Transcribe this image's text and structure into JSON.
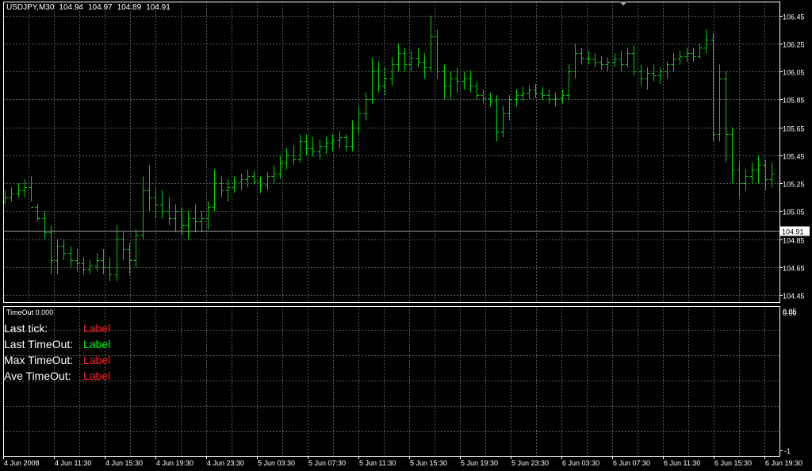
{
  "window": {
    "symbol": "USDJPY,M30",
    "ohlc": [
      "104.94",
      "104.97",
      "104.89",
      "104.91"
    ]
  },
  "colors": {
    "background": "#000000",
    "grid": "#5a5a5a",
    "bar": "#00d000",
    "axis": "#ffffff",
    "price_tag_bg": "#ffffff",
    "price_tag_fg": "#000000",
    "label_red": "#ff2020",
    "label_green": "#00ff00"
  },
  "price_axis": {
    "labels": [
      "106.45",
      "106.25",
      "106.05",
      "105.85",
      "105.65",
      "105.45",
      "105.25",
      "105.05",
      "104.85",
      "104.65",
      "104.45"
    ],
    "current_price": "104.91"
  },
  "indicator": {
    "title": "TimeOut 0.000",
    "scale_top": "0.05",
    "scale_top2": "0.00",
    "scale_bottom": "-1",
    "rows": [
      {
        "label": "Last tick:",
        "value": "Label",
        "color": "#ff2020"
      },
      {
        "label": "Last TimeOut:",
        "value": "Label",
        "color": "#00ff00"
      },
      {
        "label": "Max TimeOut:",
        "value": "Label",
        "color": "#ff2020"
      },
      {
        "label": "Ave TimeOut:",
        "value": "Label",
        "color": "#ff2020"
      }
    ]
  },
  "time_axis": {
    "labels": [
      "4 Jun 2008",
      "4 Jun 11:30",
      "4 Jun 15:30",
      "4 Jun 19:30",
      "4 Jun 23:30",
      "5 Jun 03:30",
      "5 Jun 07:30",
      "5 Jun 11:30",
      "5 Jun 15:30",
      "5 Jun 19:30",
      "5 Jun 23:30",
      "6 Jun 03:30",
      "6 Jun 07:30",
      "6 Jun 11:30",
      "6 Jun 15:30",
      "6 Jun 19:30"
    ]
  },
  "chart_data": {
    "type": "ohlc",
    "ylim": [
      104.4,
      106.55
    ],
    "grid": true,
    "series": [
      {
        "bars": [
          [
            105.12,
            105.2,
            105.1,
            105.15
          ],
          [
            105.15,
            105.22,
            105.12,
            105.18
          ],
          [
            105.18,
            105.25,
            105.15,
            105.2
          ],
          [
            105.2,
            105.28,
            105.15,
            105.22
          ],
          [
            105.22,
            105.3,
            105.12,
            105.08
          ],
          [
            105.08,
            105.1,
            104.98,
            105.0
          ],
          [
            105.0,
            105.05,
            104.85,
            104.9
          ],
          [
            104.9,
            104.95,
            104.6,
            104.7
          ],
          [
            104.7,
            104.85,
            104.6,
            104.8
          ],
          [
            104.8,
            104.85,
            104.7,
            104.75
          ],
          [
            104.75,
            104.8,
            104.65,
            104.7
          ],
          [
            104.7,
            104.78,
            104.62,
            104.68
          ],
          [
            104.68,
            104.72,
            104.6,
            104.64
          ],
          [
            104.64,
            104.7,
            104.6,
            104.66
          ],
          [
            104.66,
            104.75,
            104.62,
            104.7
          ],
          [
            104.7,
            104.78,
            104.6,
            104.65
          ],
          [
            104.65,
            104.72,
            104.55,
            104.6
          ],
          [
            104.6,
            104.95,
            104.55,
            104.85
          ],
          [
            104.85,
            104.9,
            104.7,
            104.78
          ],
          [
            104.78,
            104.82,
            104.6,
            104.7
          ],
          [
            104.7,
            104.92,
            104.65,
            104.88
          ],
          [
            104.88,
            105.3,
            104.85,
            105.2
          ],
          [
            105.2,
            105.38,
            105.05,
            105.15
          ],
          [
            105.15,
            105.22,
            105.0,
            105.1
          ],
          [
            105.1,
            105.2,
            105.0,
            105.05
          ],
          [
            105.05,
            105.15,
            104.95,
            105.0
          ],
          [
            105.0,
            105.1,
            104.9,
            105.05
          ],
          [
            105.05,
            105.08,
            104.88,
            104.95
          ],
          [
            104.95,
            105.05,
            104.85,
            105.0
          ],
          [
            105.0,
            105.1,
            104.9,
            104.98
          ],
          [
            104.98,
            105.05,
            104.9,
            105.0
          ],
          [
            105.0,
            105.12,
            104.92,
            105.08
          ],
          [
            105.08,
            105.35,
            105.05,
            105.25
          ],
          [
            105.25,
            105.3,
            105.15,
            105.2
          ],
          [
            105.2,
            105.28,
            105.12,
            105.22
          ],
          [
            105.22,
            105.3,
            105.18,
            105.26
          ],
          [
            105.26,
            105.32,
            105.2,
            105.28
          ],
          [
            105.28,
            105.35,
            105.22,
            105.3
          ],
          [
            105.3,
            105.34,
            105.24,
            105.26
          ],
          [
            105.26,
            105.3,
            105.18,
            105.24
          ],
          [
            105.24,
            105.33,
            105.2,
            105.3
          ],
          [
            105.3,
            105.38,
            105.25,
            105.32
          ],
          [
            105.32,
            105.45,
            105.28,
            105.4
          ],
          [
            105.4,
            105.5,
            105.35,
            105.45
          ],
          [
            105.45,
            105.52,
            105.38,
            105.42
          ],
          [
            105.42,
            105.6,
            105.4,
            105.55
          ],
          [
            105.55,
            105.6,
            105.45,
            105.5
          ],
          [
            105.5,
            105.58,
            105.44,
            105.48
          ],
          [
            105.48,
            105.56,
            105.42,
            105.52
          ],
          [
            105.52,
            105.58,
            105.46,
            105.54
          ],
          [
            105.54,
            105.6,
            105.48,
            105.56
          ],
          [
            105.56,
            105.62,
            105.5,
            105.58
          ],
          [
            105.58,
            105.6,
            105.48,
            105.52
          ],
          [
            105.52,
            105.7,
            105.48,
            105.65
          ],
          [
            105.65,
            105.8,
            105.6,
            105.75
          ],
          [
            105.75,
            105.9,
            105.7,
            105.85
          ],
          [
            105.85,
            106.15,
            105.82,
            106.05
          ],
          [
            106.05,
            106.12,
            105.9,
            105.95
          ],
          [
            105.95,
            106.08,
            105.88,
            106.0
          ],
          [
            106.0,
            106.15,
            105.95,
            106.1
          ],
          [
            106.1,
            106.25,
            106.05,
            106.18
          ],
          [
            106.18,
            106.22,
            106.05,
            106.1
          ],
          [
            106.1,
            106.2,
            106.05,
            106.15
          ],
          [
            106.15,
            106.22,
            106.08,
            106.12
          ],
          [
            106.12,
            106.18,
            106.0,
            106.08
          ],
          [
            106.08,
            106.45,
            106.05,
            106.3
          ],
          [
            106.3,
            106.35,
            106.0,
            106.05
          ],
          [
            106.05,
            106.1,
            105.85,
            105.95
          ],
          [
            105.95,
            106.05,
            105.85,
            106.0
          ],
          [
            106.0,
            106.08,
            105.9,
            105.98
          ],
          [
            105.98,
            106.05,
            105.92,
            106.0
          ],
          [
            106.0,
            106.06,
            105.9,
            105.95
          ],
          [
            105.95,
            105.98,
            105.85,
            105.88
          ],
          [
            105.88,
            105.92,
            105.82,
            105.86
          ],
          [
            105.86,
            105.9,
            105.8,
            105.84
          ],
          [
            105.84,
            105.88,
            105.55,
            105.62
          ],
          [
            105.62,
            105.8,
            105.58,
            105.75
          ],
          [
            105.75,
            105.88,
            105.7,
            105.85
          ],
          [
            105.85,
            105.92,
            105.8,
            105.88
          ],
          [
            105.88,
            105.94,
            105.84,
            105.9
          ],
          [
            105.9,
            105.95,
            105.85,
            105.92
          ],
          [
            105.92,
            105.96,
            105.86,
            105.9
          ],
          [
            105.9,
            105.94,
            105.84,
            105.88
          ],
          [
            105.88,
            105.92,
            105.82,
            105.85
          ],
          [
            105.85,
            105.9,
            105.8,
            105.86
          ],
          [
            105.86,
            105.92,
            105.82,
            105.88
          ],
          [
            105.88,
            106.1,
            105.85,
            106.05
          ],
          [
            106.05,
            106.25,
            106.0,
            106.18
          ],
          [
            106.18,
            106.22,
            106.1,
            106.15
          ],
          [
            106.15,
            106.2,
            106.1,
            106.14
          ],
          [
            106.14,
            106.18,
            106.08,
            106.12
          ],
          [
            106.12,
            106.16,
            106.06,
            106.1
          ],
          [
            106.1,
            106.15,
            106.05,
            106.12
          ],
          [
            106.12,
            106.18,
            106.08,
            106.14
          ],
          [
            106.14,
            106.2,
            106.05,
            106.1
          ],
          [
            106.1,
            106.22,
            106.08,
            106.18
          ],
          [
            106.18,
            106.24,
            106.02,
            106.05
          ],
          [
            106.05,
            106.1,
            105.95,
            106.0
          ],
          [
            106.0,
            106.08,
            105.92,
            106.04
          ],
          [
            106.04,
            106.1,
            105.98,
            106.02
          ],
          [
            106.02,
            106.08,
            105.96,
            106.05
          ],
          [
            106.05,
            106.12,
            106.0,
            106.1
          ],
          [
            106.1,
            106.18,
            106.05,
            106.14
          ],
          [
            106.14,
            106.2,
            106.1,
            106.16
          ],
          [
            106.16,
            106.22,
            106.12,
            106.18
          ],
          [
            106.18,
            106.22,
            106.12,
            106.16
          ],
          [
            106.16,
            106.25,
            106.14,
            106.22
          ],
          [
            106.22,
            106.35,
            106.18,
            106.28
          ],
          [
            106.28,
            106.32,
            105.55,
            105.6
          ],
          [
            105.6,
            106.1,
            105.55,
            106.0
          ],
          [
            106.0,
            106.05,
            105.4,
            105.6
          ],
          [
            105.6,
            105.65,
            105.25,
            105.35
          ],
          [
            105.35,
            105.4,
            105.15,
            105.25
          ],
          [
            105.25,
            105.35,
            105.2,
            105.3
          ],
          [
            105.3,
            105.4,
            105.25,
            105.35
          ],
          [
            105.35,
            105.45,
            105.25,
            105.38
          ],
          [
            105.38,
            105.42,
            105.2,
            105.28
          ],
          [
            105.28,
            105.4,
            105.22,
            105.32
          ]
        ]
      }
    ]
  }
}
